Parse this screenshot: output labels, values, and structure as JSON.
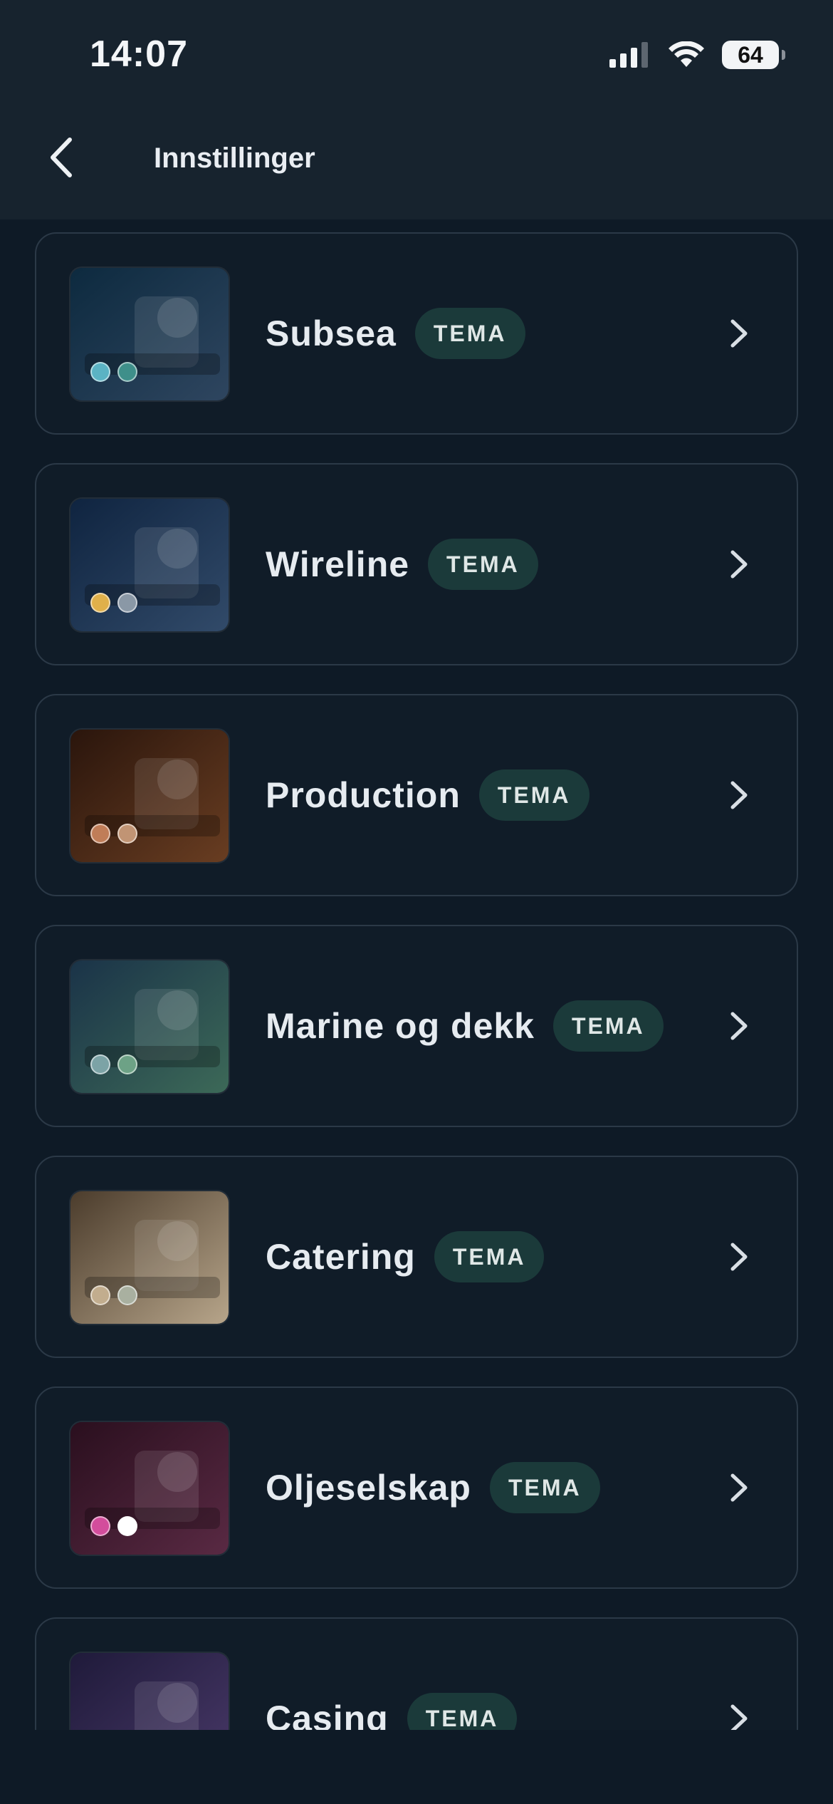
{
  "status_bar": {
    "time": "14:07",
    "battery": "64"
  },
  "nav": {
    "title": "Innstillinger",
    "back_icon": "chevron-left-icon"
  },
  "colors": {
    "tag_bg": "#1b3a3a",
    "card_border": "#2b3947"
  },
  "themes": [
    {
      "name": "Subsea",
      "tag": "TEMA",
      "dot1": "#5bb3c4",
      "dot2": "#3e8f8a",
      "thumb_from": "#0d2a3f",
      "thumb_to": "#2f4660"
    },
    {
      "name": "Wireline",
      "tag": "TEMA",
      "dot1": "#e0b04a",
      "dot2": "#8a98a6",
      "thumb_from": "#0f2440",
      "thumb_to": "#324b6a"
    },
    {
      "name": "Production",
      "tag": "TEMA",
      "dot1": "#c07d58",
      "dot2": "#c19474",
      "thumb_from": "#2a150c",
      "thumb_to": "#6a3e22"
    },
    {
      "name": "Marine og dekk",
      "tag": "TEMA",
      "dot1": "#7ca3a6",
      "dot2": "#6da286",
      "thumb_from": "#1a3348",
      "thumb_to": "#3d6a58"
    },
    {
      "name": "Catering",
      "tag": "TEMA",
      "dot1": "#c2ad8e",
      "dot2": "#a9b0a0",
      "thumb_from": "#4b3c2c",
      "thumb_to": "#b9a78c"
    },
    {
      "name": "Oljeselskap",
      "tag": "TEMA",
      "dot1": "#d34d9c",
      "dot2": "#ffffff",
      "thumb_from": "#2a0f1e",
      "thumb_to": "#5a2a44"
    },
    {
      "name": "Casing",
      "tag": "TEMA",
      "dot1": "#8a6bc2",
      "dot2": "#b79ad8",
      "thumb_from": "#1f1a3a",
      "thumb_to": "#4a3a6a"
    }
  ]
}
